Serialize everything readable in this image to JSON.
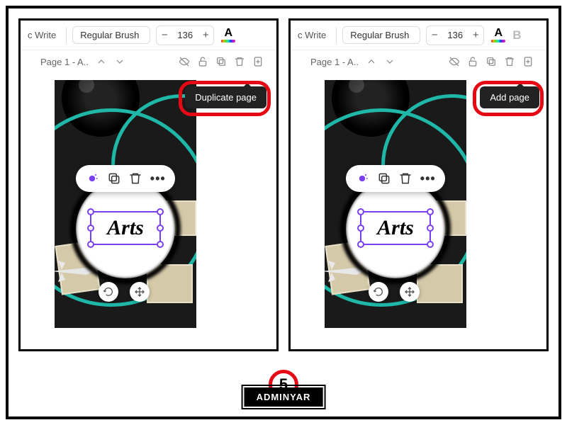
{
  "toolbar": {
    "write": "c Write",
    "font": "Regular Brush",
    "minus": "−",
    "size": "136",
    "plus": "+",
    "bold": "B"
  },
  "pageRow": {
    "label": "Page 1 - A.."
  },
  "tooltips": {
    "left": "Duplicate page",
    "right": "Add page"
  },
  "canvas": {
    "artsText": "Arts",
    "more": "•••"
  },
  "step": "5",
  "credit": "ADMINYAR"
}
